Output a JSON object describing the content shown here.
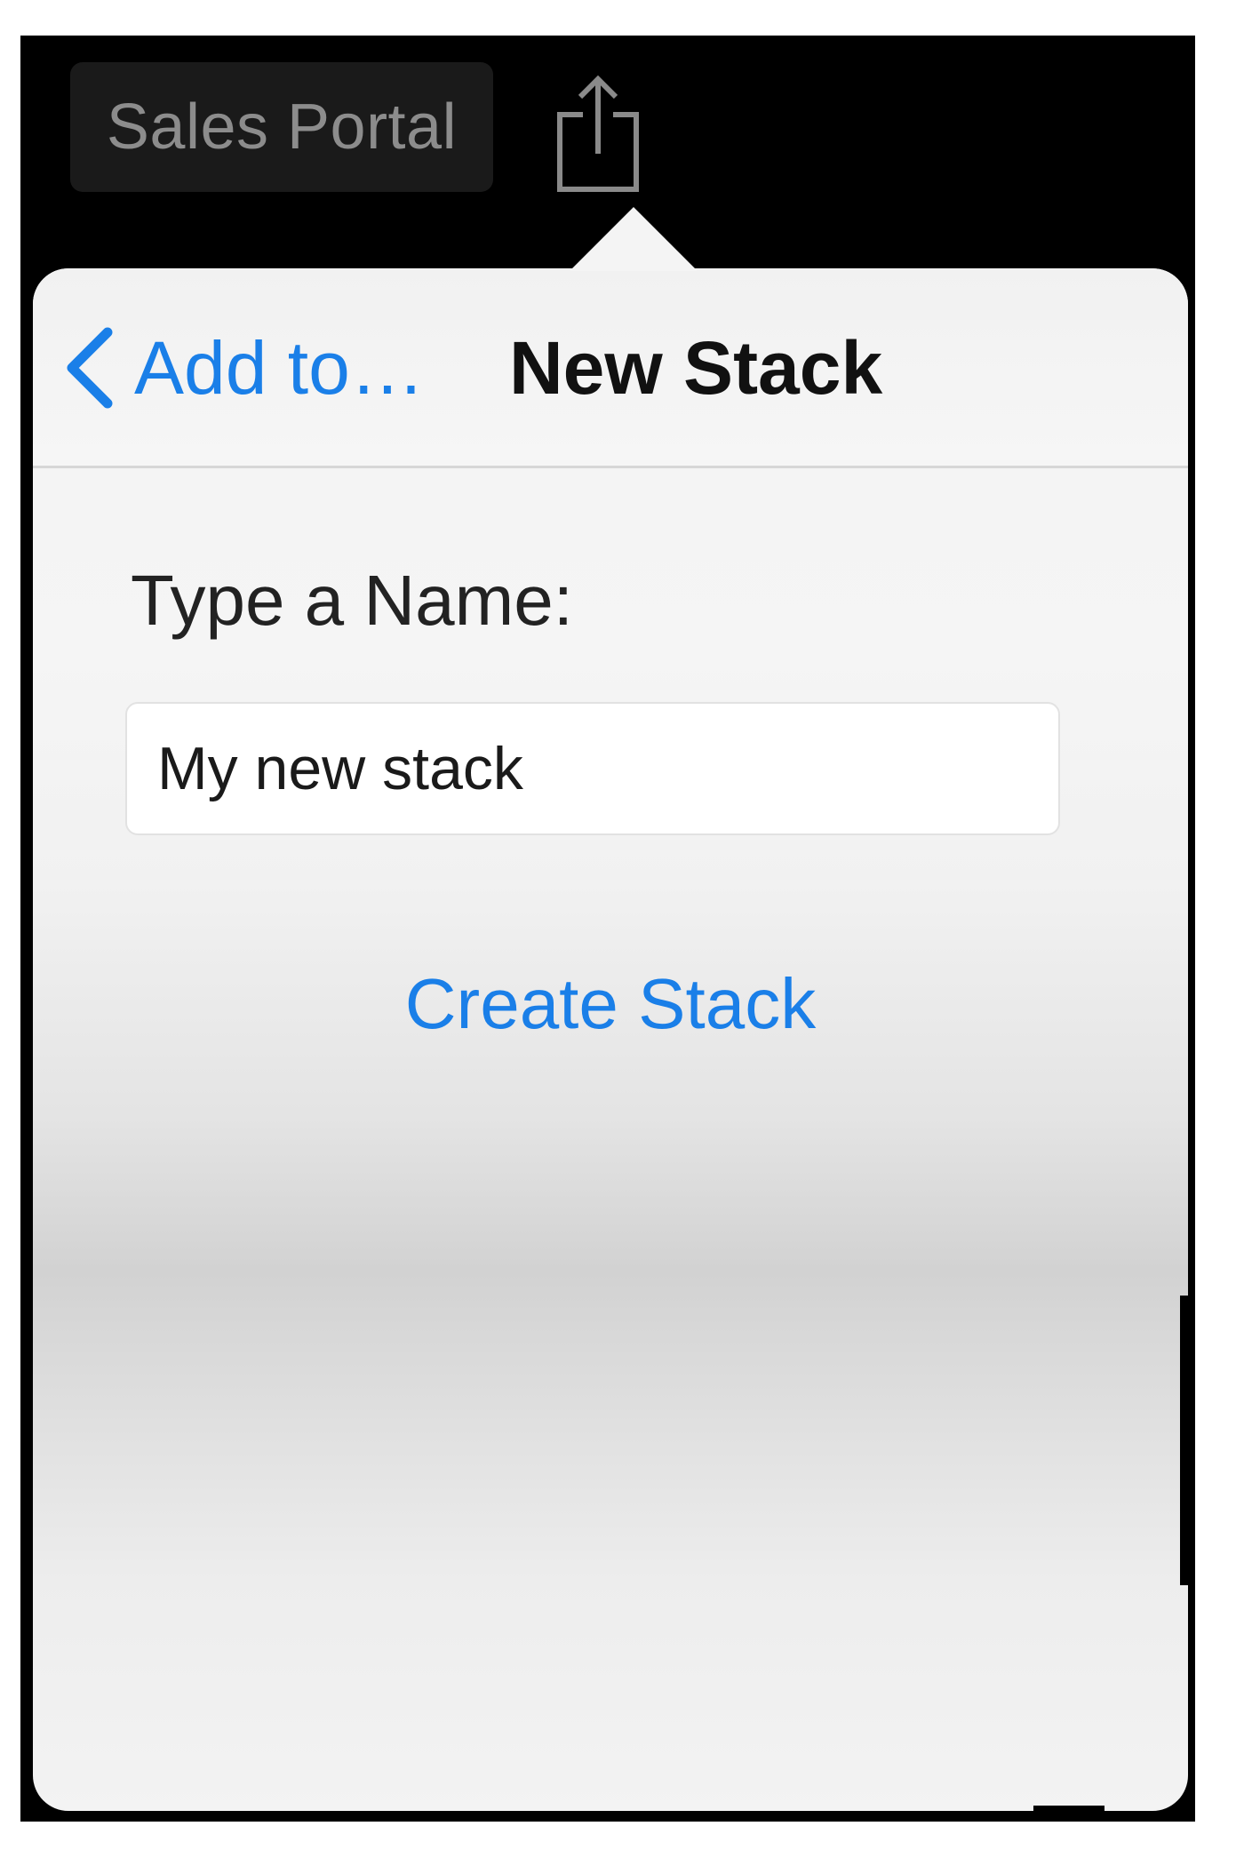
{
  "topbar": {
    "app_label": "Sales Portal",
    "share_icon": "share-icon"
  },
  "popover": {
    "nav": {
      "back_label": "Add to…",
      "back_icon": "chevron-left-icon",
      "title": "New Stack"
    },
    "form": {
      "label": "Type a Name:",
      "input_value": "My new stack"
    },
    "create_label": "Create Stack"
  },
  "colors": {
    "accent": "#1a7fe8",
    "topbar": "#000000",
    "popover_bg": "#f3f3f3",
    "app_button_bg": "#1a1a1a",
    "app_button_text": "#8c8c8c"
  }
}
